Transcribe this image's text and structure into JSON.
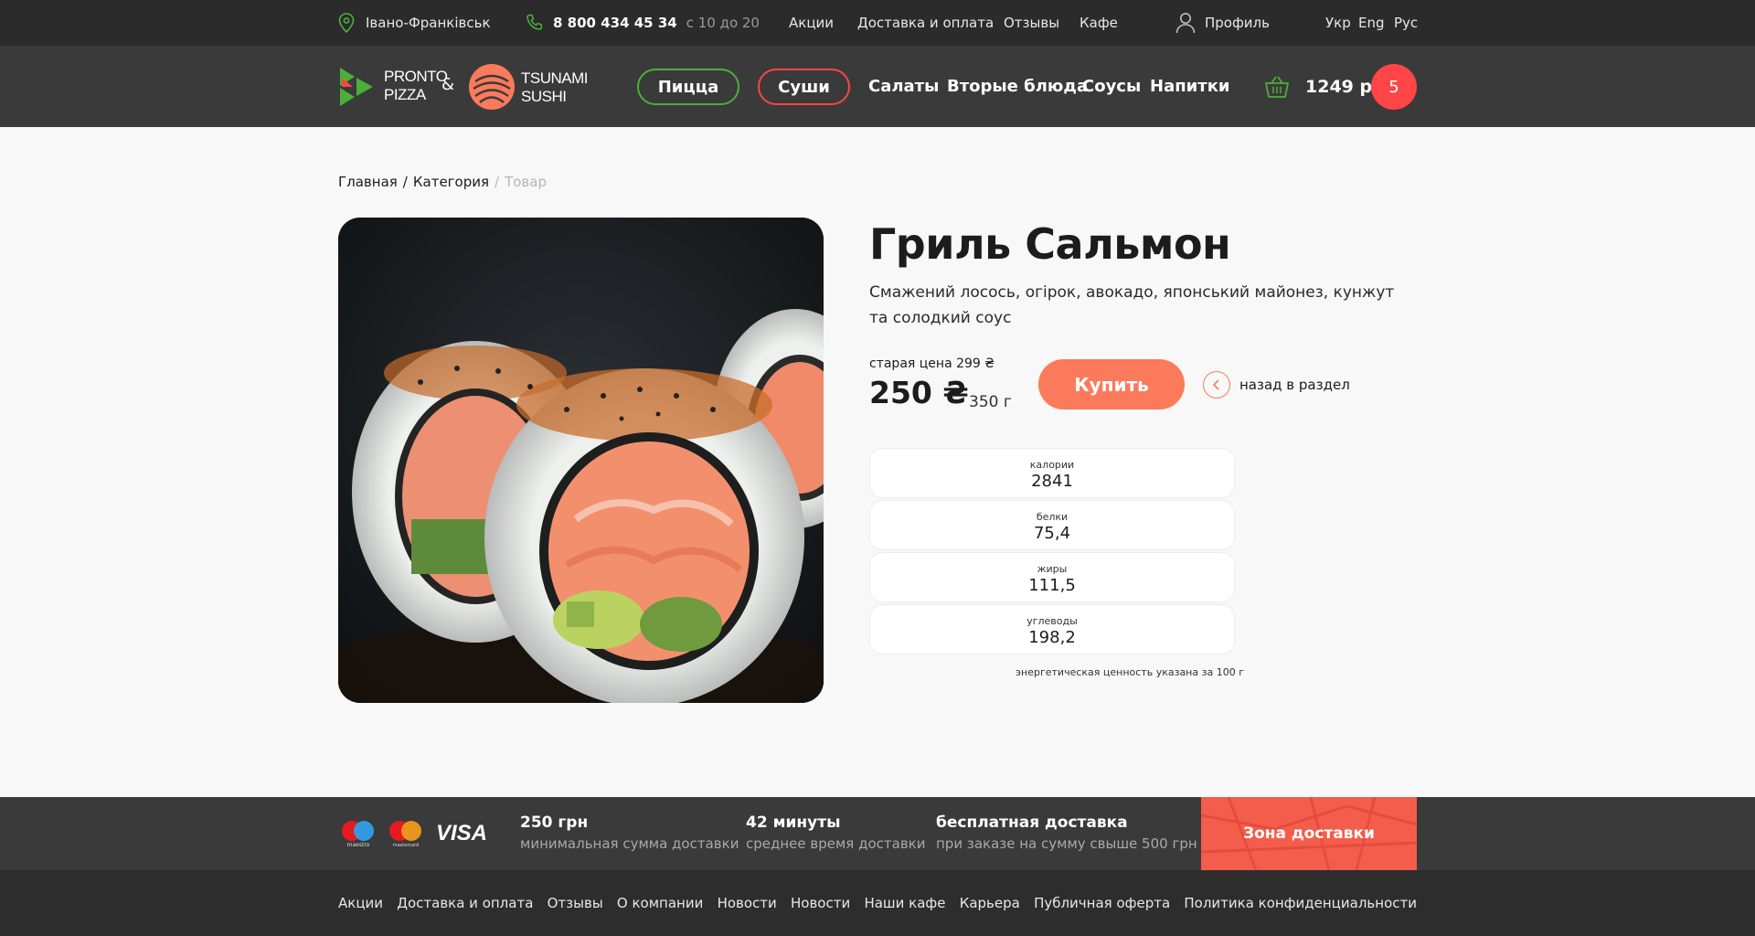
{
  "topbar": {
    "city": "Івано-Франківськ",
    "phone": "8 800 434 45 34",
    "hours": "с 10 до 20",
    "links": [
      "Акции",
      "Доставка и оплата",
      "Отзывы",
      "Кафе"
    ],
    "profile": "Профиль",
    "languages": [
      "Укр",
      "Eng",
      "Рус"
    ]
  },
  "header": {
    "brand1_line1": "PRONTO",
    "brand1_line2": "PIZZA",
    "ampersand": "&",
    "brand2_line1": "TSUNAMI",
    "brand2_line2": "SUSHI",
    "nav": [
      "Пицца",
      "Суши",
      "Салаты",
      "Вторые блюда",
      "Соусы",
      "Напитки"
    ],
    "cart_total": "1249 р",
    "cart_count": "5",
    "colors": {
      "pizza": "#4caf3a",
      "sushi": "#ff4545",
      "badge": "#ff4545"
    }
  },
  "breadcrumb": {
    "home": "Главная",
    "category": "Категория",
    "current": "Товар"
  },
  "product": {
    "title": "Гриль Сальмон",
    "description": "Смажений лосось, огірок, авокадо, японський майонез, кунжут та солодкий соус",
    "old_price": "старая цена 299 ₴",
    "price": "250 ₴",
    "weight": "350 г",
    "buy_label": "Купить",
    "back_label": "назад в раздел",
    "nutrition": [
      {
        "label": "калории",
        "value": "2841"
      },
      {
        "label": "белки",
        "value": "75,4"
      },
      {
        "label": "жиры",
        "value": "111,5"
      },
      {
        "label": "углеводы",
        "value": "198,2"
      }
    ],
    "note": "энергетическая ценность указана за 100 г"
  },
  "infobar": {
    "payments": [
      "maestro",
      "mastercard",
      "VISA"
    ],
    "items": [
      {
        "title": "250 грн",
        "subtitle": "минимальная сумма доставки"
      },
      {
        "title": "42 минуты",
        "subtitle": "среднее время доставки"
      },
      {
        "title": "бесплатная доставка",
        "subtitle": "при заказе на сумму свыше 500 грн"
      }
    ],
    "zone_label": "Зона доставки"
  },
  "footer": {
    "links": [
      "Акции",
      "Доставка и оплата",
      "Отзывы",
      "О компании",
      "Новости",
      "Новости",
      "Наши кафе",
      "Карьера",
      "Публичная оферта",
      "Политика конфиденциальности"
    ]
  }
}
